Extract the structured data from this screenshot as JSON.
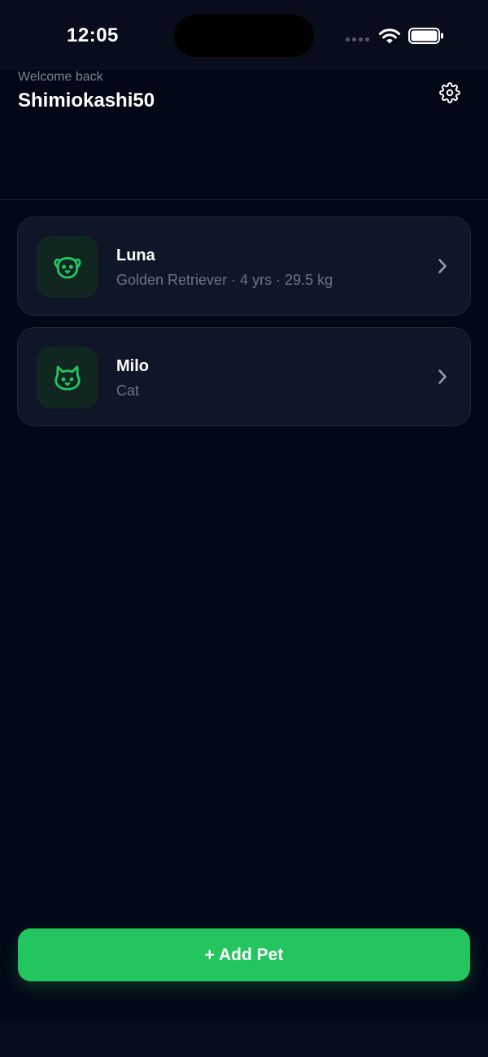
{
  "status_bar": {
    "time": "12:05"
  },
  "header": {
    "welcome": "Welcome back",
    "username": "Shimiokashi50",
    "settings_icon": "gear-icon"
  },
  "pets": [
    {
      "name": "Luna",
      "details": "Golden Retriever · 4 yrs · 29.5 kg",
      "icon": "dog-icon"
    },
    {
      "name": "Milo",
      "details": "Cat",
      "icon": "cat-icon"
    }
  ],
  "actions": {
    "add_pet_label": "+ Add Pet"
  },
  "colors": {
    "background": "#030816",
    "card": "#0f1627",
    "accent": "#22c55e",
    "muted_text": "#6c7388"
  }
}
